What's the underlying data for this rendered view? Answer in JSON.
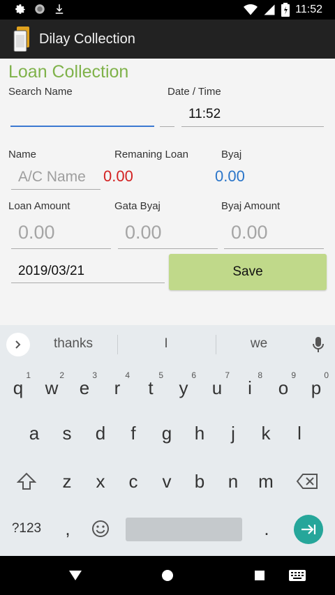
{
  "status": {
    "time": "11:52"
  },
  "appbar": {
    "title": "Dilay Collection"
  },
  "form": {
    "heading": "Loan Collection",
    "search_name_label": "Search Name",
    "date_time_label": "Date / Time",
    "time_value": "11:52",
    "name_label": "Name",
    "remaining_loan_label": "Remaning Loan",
    "byaj_label": "Byaj",
    "name_placeholder": "A/C Name",
    "remaining_loan_value": "0.00",
    "byaj_value": "0.00",
    "loan_amount_label": "Loan Amount",
    "gata_byaj_label": "Gata Byaj",
    "byaj_amount_label": "Byaj Amount",
    "loan_amount_placeholder": "0.00",
    "gata_byaj_placeholder": "0.00",
    "byaj_amount_placeholder": "0.00",
    "date_value": "2019/03/21",
    "save_label": "Save"
  },
  "keyboard": {
    "suggestions": [
      "thanks",
      "I",
      "we"
    ],
    "row1": [
      {
        "k": "q",
        "n": "1"
      },
      {
        "k": "w",
        "n": "2"
      },
      {
        "k": "e",
        "n": "3"
      },
      {
        "k": "r",
        "n": "4"
      },
      {
        "k": "t",
        "n": "5"
      },
      {
        "k": "y",
        "n": "6"
      },
      {
        "k": "u",
        "n": "7"
      },
      {
        "k": "i",
        "n": "8"
      },
      {
        "k": "o",
        "n": "9"
      },
      {
        "k": "p",
        "n": "0"
      }
    ],
    "row2": [
      "a",
      "s",
      "d",
      "f",
      "g",
      "h",
      "j",
      "k",
      "l"
    ],
    "row3": [
      "z",
      "x",
      "c",
      "v",
      "b",
      "n",
      "m"
    ],
    "symbols_label": "?123",
    "comma": ",",
    "period": ".",
    "icons": [
      "settings-icon",
      "circle-icon",
      "download-icon",
      "wifi-icon",
      "signal-icon",
      "battery-icon",
      "mic-icon",
      "shift-icon",
      "backspace-icon",
      "emoji-icon",
      "enter-icon",
      "back-icon",
      "home-icon",
      "recents-icon",
      "keyboard-icon"
    ]
  }
}
